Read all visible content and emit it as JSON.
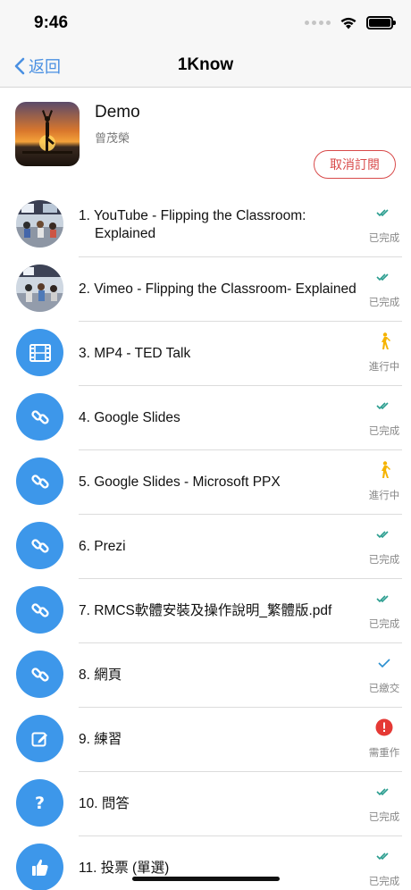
{
  "status_bar": {
    "time": "9:46"
  },
  "nav": {
    "back_label": "返回",
    "title": "1Know"
  },
  "course": {
    "title": "Demo",
    "teacher": "曾茂榮",
    "unsubscribe_label": "取消訂閱"
  },
  "colors": {
    "accent": "#4a90e2",
    "icon_bg": "#3d97ea",
    "done_check": "#2a9d8f",
    "progress": "#f5b300",
    "redo": "#e53935",
    "unsubscribe": "#d84a4a"
  },
  "units": [
    {
      "title": "1. YouTube - Flipping the Classroom: Explained",
      "icon": "video-thumbnail",
      "status": "已完成",
      "status_icon": "double-check-icon"
    },
    {
      "title": "2. Vimeo - Flipping the Classroom- Explained",
      "icon": "video-thumbnail",
      "status": "已完成",
      "status_icon": "double-check-icon"
    },
    {
      "title": "3. MP4 - TED Talk",
      "icon": "film-icon",
      "status": "進行中",
      "status_icon": "walking-person-icon"
    },
    {
      "title": "4. Google Slides",
      "icon": "link-icon",
      "status": "已完成",
      "status_icon": "double-check-icon"
    },
    {
      "title": "5. Google Slides - Microsoft PPX",
      "icon": "link-icon",
      "status": "進行中",
      "status_icon": "walking-person-icon"
    },
    {
      "title": "6. Prezi",
      "icon": "link-icon",
      "status": "已完成",
      "status_icon": "double-check-icon"
    },
    {
      "title": "7. RMCS軟體安裝及操作說明_繁體版.pdf",
      "icon": "link-icon",
      "status": "已完成",
      "status_icon": "double-check-icon"
    },
    {
      "title": "8. 網頁",
      "icon": "link-icon",
      "status": "已繳交",
      "status_icon": "single-check-icon"
    },
    {
      "title": "9. 練習",
      "icon": "edit-icon",
      "status": "需重作",
      "status_icon": "alert-icon"
    },
    {
      "title": "10. 問答",
      "icon": "question-icon",
      "status": "已完成",
      "status_icon": "double-check-icon"
    },
    {
      "title": "11. 投票 (單選)",
      "icon": "thumbs-up-icon",
      "status": "已完成",
      "status_icon": "double-check-icon"
    }
  ]
}
